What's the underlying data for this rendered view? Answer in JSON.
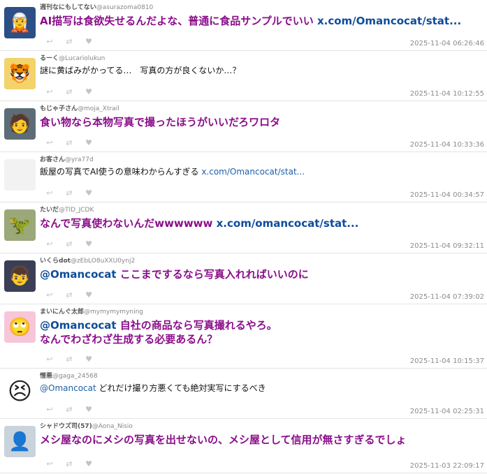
{
  "posts": [
    {
      "user": "週刊なにもしてない",
      "handle": "@asurazoma0810",
      "avatar_icon": "anime-girl-icon",
      "avatar_glyph": "🧝",
      "avatar_bg": "#2b4f86",
      "text": "AI描写は食欲失せるんだよな、普通に食品サンプルでいい ",
      "link": "x.com/Omancocat/stat...",
      "style": "big",
      "timestamp": "2025-11-04 06:26:46"
    },
    {
      "user": "るーく",
      "handle": "@Lucariolukun",
      "avatar_icon": "tiger-character-icon",
      "avatar_glyph": "🐯",
      "avatar_bg": "#f3d36b",
      "text": "謎に黄ばみがかってる…　写真の方が良くないか…？",
      "link": "",
      "style": "small",
      "timestamp": "2025-11-04 10:12:55"
    },
    {
      "user": "もじゃ子さん",
      "handle": "@moja_Xtrail",
      "avatar_icon": "person-photo-icon",
      "avatar_glyph": "🧑",
      "avatar_bg": "#5d6d78",
      "text": "食い物なら本物写真で撮ったほうがいいだろワロタ",
      "link": "",
      "style": "big",
      "timestamp": "2025-11-04 10:33:36"
    },
    {
      "user": "お客さん",
      "handle": "@yra77d",
      "avatar_icon": "blank-avatar-icon",
      "avatar_glyph": "",
      "avatar_bg": "#f2f2f2",
      "text": "飯屋の写真でAI使うの意味わからんすぎる ",
      "link": "x.com/Omancocat/stat...",
      "style": "small",
      "timestamp": "2025-11-04 00:34:57"
    },
    {
      "user": "たいだ",
      "handle": "@TID_JCDK",
      "avatar_icon": "figure-photo-icon",
      "avatar_glyph": "🦖",
      "avatar_bg": "#9aa87a",
      "text": "なんで写真使わないんだwwwwww ",
      "link": "x.com/omancocat/stat...",
      "style": "big",
      "timestamp": "2025-11-04 09:32:11"
    },
    {
      "user": "いくらdot",
      "handle": "@zEbLO8uXXU0ynj2",
      "avatar_icon": "anime-boy-icon",
      "avatar_glyph": "👦",
      "avatar_bg": "#3b3f56",
      "mention": "@Omancocat",
      "text": " ここまでするなら写真入れればいいのに",
      "link": "",
      "style": "big",
      "timestamp": "2025-11-04 07:39:02"
    },
    {
      "user": "まいにんぐ太郎",
      "handle": "@mymymymyning",
      "avatar_icon": "emoji-face-icon",
      "avatar_glyph": "🙄",
      "avatar_bg": "#f7c6d9",
      "mention": "@Omancocat",
      "text": " 自社の商品なら写真撮れるやろ。\nなんでわざわざ生成する必要あるん？",
      "link": "",
      "style": "big",
      "timestamp": "2025-11-04 10:15:37"
    },
    {
      "user": "憎悪",
      "handle": "@gaga_24568",
      "avatar_icon": "angry-face-icon",
      "avatar_glyph": "😣",
      "avatar_bg": "#ffffff",
      "mention": "@Omancocat",
      "text": " どれだけ撮り方悪くても絶対実写にするべき",
      "link": "",
      "style": "small",
      "timestamp": "2025-11-04 02:25:31"
    },
    {
      "user": "シャドウズ司(57)",
      "handle": "@Aona_Nisio",
      "avatar_icon": "gray-character-icon",
      "avatar_glyph": "👤",
      "avatar_bg": "#c9d3dc",
      "text": "メシ屋なのにメシの写真を出せないの、メシ屋として信用が無さすぎるでしょ",
      "link": "",
      "style": "big",
      "timestamp": "2025-11-03 22:09:17"
    }
  ],
  "action_icons": {
    "reply": "↩",
    "retweet": "⇄",
    "like": "♥"
  }
}
